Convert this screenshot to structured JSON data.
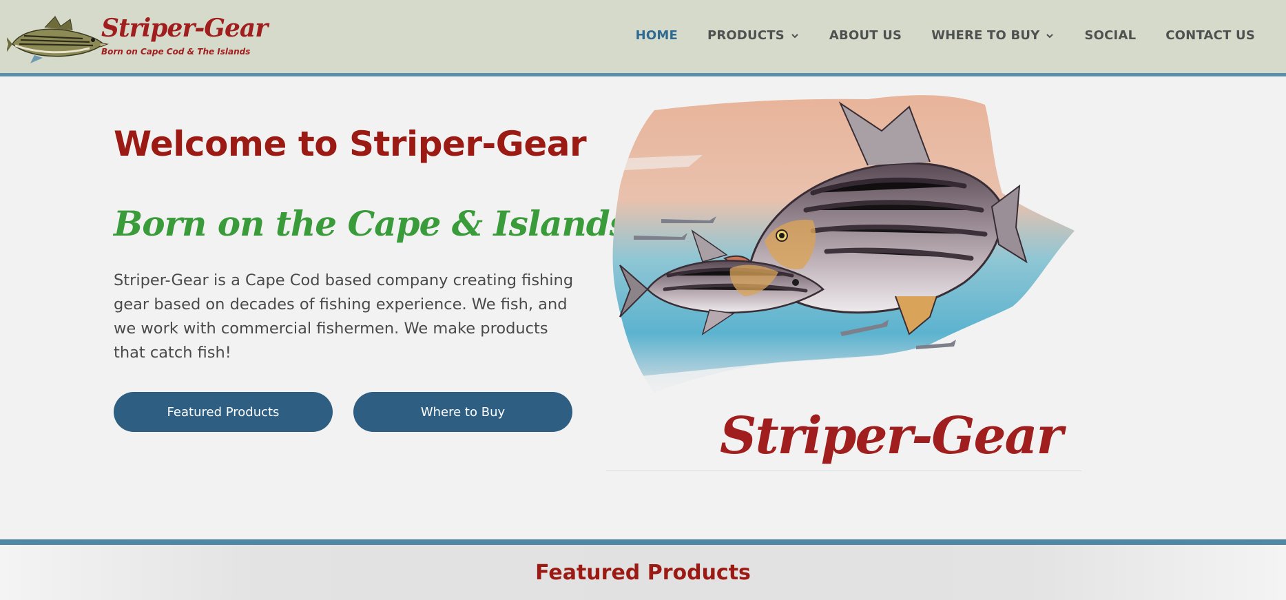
{
  "header": {
    "logo_title": "Striper-Gear",
    "logo_subtitle": "Born on Cape Cod & The Islands",
    "nav": [
      {
        "label": "HOME",
        "active": true,
        "has_dropdown": false
      },
      {
        "label": "PRODUCTS",
        "active": false,
        "has_dropdown": true
      },
      {
        "label": "ABOUT US",
        "active": false,
        "has_dropdown": false
      },
      {
        "label": "WHERE TO BUY",
        "active": false,
        "has_dropdown": true
      },
      {
        "label": "SOCIAL",
        "active": false,
        "has_dropdown": false
      },
      {
        "label": "CONTACT US",
        "active": false,
        "has_dropdown": false
      }
    ]
  },
  "hero": {
    "title": "Welcome to Striper-Gear",
    "subtitle": "Born on the Cape & Islands",
    "description": "Striper-Gear is a Cape Cod based company creating fishing gear based on decades of fishing experience. We fish, and we work with commercial fishermen. We make products that catch fish!",
    "buttons": {
      "featured": "Featured Products",
      "where": "Where to Buy"
    },
    "art_brand": "Striper-Gear"
  },
  "featured_section": {
    "title": "Featured Products"
  },
  "colors": {
    "header_bg": "#d5dacb",
    "accent_blue": "#2e5e82",
    "brand_red": "#9b1a14",
    "tagline_green": "#3a9b3a",
    "nav_active": "#2e6a92"
  },
  "icons": {
    "logo": "striped-bass-fish-icon",
    "dropdown": "chevron-down-icon"
  }
}
